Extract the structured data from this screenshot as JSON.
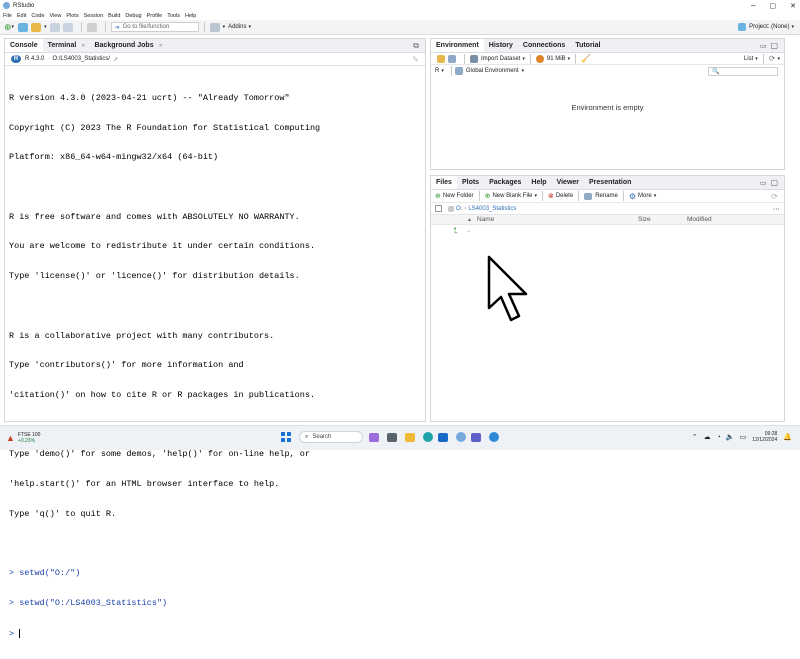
{
  "titlebar": {
    "title": "RStudio"
  },
  "menubar": {
    "items": [
      "File",
      "Edit",
      "Code",
      "View",
      "Plots",
      "Session",
      "Build",
      "Debug",
      "Profile",
      "Tools",
      "Help"
    ]
  },
  "toolbar": {
    "goto_placeholder": "Go to file/function",
    "addins_label": "Addins",
    "project_label": "Project: (None)"
  },
  "console_pane": {
    "tabs": [
      "Console",
      "Terminal",
      "Background Jobs"
    ],
    "r_version_label": "R 4.3.0",
    "path": "O:/LS4003_Statistics/",
    "output_lines": [
      "R version 4.3.0 (2023-04-21 ucrt) -- \"Already Tomorrow\"",
      "Copyright (C) 2023 The R Foundation for Statistical Computing",
      "Platform: x86_64-w64-mingw32/x64 (64-bit)",
      "",
      "R is free software and comes with ABSOLUTELY NO WARRANTY.",
      "You are welcome to redistribute it under certain conditions.",
      "Type 'license()' or 'licence()' for distribution details.",
      "",
      "R is a collaborative project with many contributors.",
      "Type 'contributors()' for more information and",
      "'citation()' on how to cite R or R packages in publications.",
      "",
      "Type 'demo()' for some demos, 'help()' for on-line help, or",
      "'help.start()' for an HTML browser interface to help.",
      "Type 'q()' to quit R.",
      ""
    ],
    "commands": [
      "> setwd(\"O:/\")",
      "> setwd(\"O:/LS4003_Statistics\")"
    ],
    "prompt": ">"
  },
  "environment_pane": {
    "tabs": [
      "Environment",
      "History",
      "Connections",
      "Tutorial"
    ],
    "import_label": "Import Dataset",
    "memory_label": "91 MiB",
    "list_label": "List",
    "r_label": "R",
    "scope_label": "Global Environment",
    "empty_message": "Environment is empty"
  },
  "files_pane": {
    "tabs": [
      "Files",
      "Plots",
      "Packages",
      "Help",
      "Viewer",
      "Presentation"
    ],
    "new_folder": "New Folder",
    "new_blank_file": "New Blank File",
    "delete": "Delete",
    "rename": "Rename",
    "more": "More",
    "breadcrumb_root": "O:",
    "breadcrumb_folder": "LS4003_Statistics",
    "columns": [
      "Name",
      "Size",
      "Modified"
    ],
    "parent_entry": ".."
  },
  "taskbar": {
    "stock_name": "FTSE 100",
    "stock_change": "+0.23%",
    "search_placeholder": "Search",
    "time": "09:28",
    "date": "12/12/2024"
  },
  "colors": {
    "accent": "#2c6bb3",
    "prompt_blue": "#1b3fa8",
    "header_bg": "#eef0f3"
  }
}
